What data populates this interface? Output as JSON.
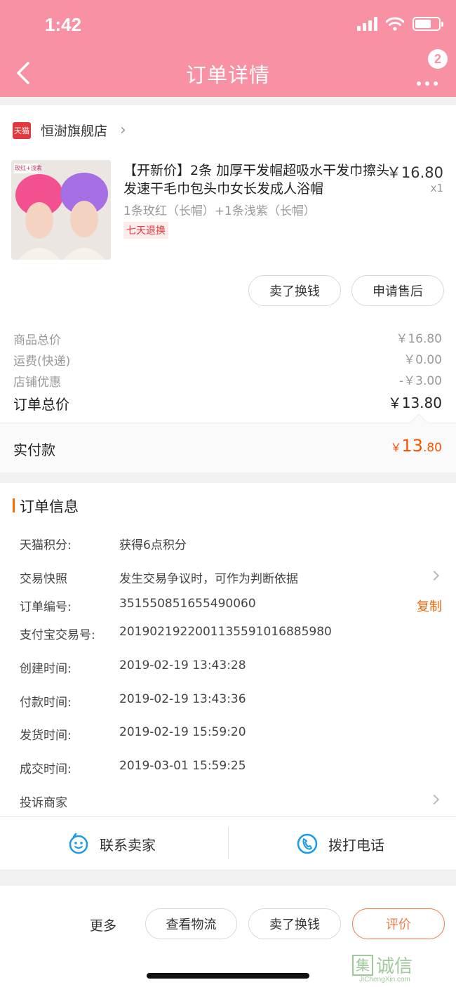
{
  "status_bar": {
    "time": "1:42"
  },
  "header": {
    "title": "订单详情",
    "badge_count": "2"
  },
  "shop": {
    "platform_badge": "天猫",
    "name": "恒澍旗舰店"
  },
  "product": {
    "image_tag": "玫红+浅紫",
    "title": "【开新价】2条 加厚干发帽超吸水干发巾擦头发速干毛巾包头巾女长发成人浴帽",
    "sku": "1条玫红（长帽）+1条浅紫（长帽）",
    "return_policy": "七天退换",
    "price": "￥16.80",
    "quantity": "x1"
  },
  "product_actions": {
    "sell_label": "卖了换钱",
    "aftersale_label": "申请售后"
  },
  "price_summary": {
    "rows": [
      {
        "label": "商品总价",
        "value": "￥16.80"
      },
      {
        "label": "运费(快递)",
        "value": "￥0.00"
      },
      {
        "label": "店铺优惠",
        "value": "-￥3.00"
      }
    ],
    "total_label": "订单总价",
    "total_value": "￥13.80"
  },
  "payment": {
    "label": "实付款",
    "currency": "￥",
    "amount_int": "13",
    "amount_dec": ".80"
  },
  "order_info": {
    "section_title": "订单信息",
    "points_label": "天猫积分:",
    "points_value": "获得6点积分",
    "snapshot_label": "交易快照",
    "snapshot_value": "发生交易争议时，可作为判断依据",
    "order_no_label": "订单编号:",
    "order_no_value": "351550851655490060",
    "copy_label": "复制",
    "alipay_label": "支付宝交易号:",
    "alipay_value": "2019021922001135591016885980",
    "created_label": "创建时间:",
    "created_value": "2019-02-19 13:43:28",
    "paid_label": "付款时间:",
    "paid_value": "2019-02-19 13:43:36",
    "shipped_label": "发货时间:",
    "shipped_value": "2019-02-19 15:59:20",
    "closed_label": "成交时间:",
    "closed_value": "2019-03-01 15:59:25",
    "complaint_label": "投诉商家"
  },
  "contact": {
    "seller_label": "联系卖家",
    "phone_label": "拨打电话"
  },
  "bottom_bar": {
    "more_label": "更多",
    "logistics_label": "查看物流",
    "sell_label": "卖了换钱",
    "review_label": "评价"
  },
  "watermark": {
    "char": "集",
    "main": "诚信",
    "site": "JiChengXin.com"
  },
  "colors": {
    "header_pink": "#f891a3",
    "accent_orange": "#ff5000",
    "tmall_red": "#e4393c"
  }
}
